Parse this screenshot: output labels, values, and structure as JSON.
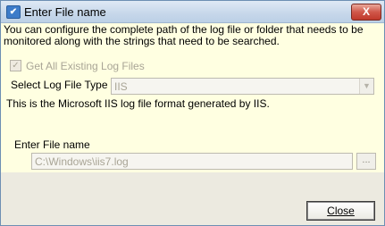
{
  "window": {
    "title": "Enter File name",
    "close_symbol": "X"
  },
  "banner": {
    "text": "You can configure the complete path of the log file or folder that needs to be monitored along with the strings that need to be searched."
  },
  "form": {
    "get_all_logs_label": "Get All Existing Log Files",
    "get_all_logs_checked": true,
    "log_type_label": "Select Log File Type",
    "log_type_value": "IIS",
    "log_type_description": "This is the Microsoft IIS log file format generated by IIS.",
    "file_name_label": "Enter File name",
    "file_name_value": "C:\\Windows\\iis7.log",
    "browse_label": "...",
    "dropdown_icon": "chevron-down-icon"
  },
  "footer": {
    "close_label": "Close"
  }
}
